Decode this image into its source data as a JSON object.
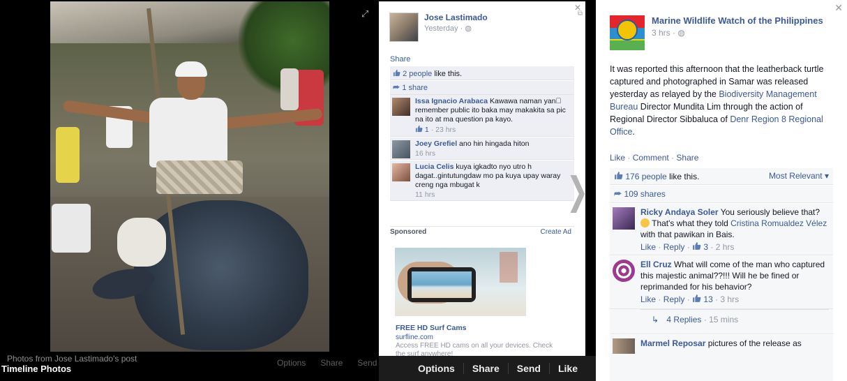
{
  "viewer": {
    "photo_caption": "Photos from Jose Lastimado's post",
    "title": "Timeline Photos",
    "dim_actions": [
      "Options",
      "Share",
      "Send"
    ],
    "actions": [
      "Options",
      "Share",
      "Send",
      "Like"
    ]
  },
  "panel": {
    "author": "Jose Lastimado",
    "time": "Yesterday ·",
    "share_label": "Share",
    "likes_count": "2 people",
    "likes_suffix": " like this.",
    "shares": "1 share",
    "comments": [
      {
        "name": "Issa Ignacio Arabaca",
        "text": " Kawawa naman yan\u0000 remember public ito baka may makakita sa pic na ito at ma question pa kayo.",
        "likes": "1",
        "time": "· 23 hrs"
      },
      {
        "name": "Joey Grefiel",
        "text": " ano hin hingada hiton",
        "time": "16 hrs"
      },
      {
        "name": "Lucia Celis",
        "text": " kuya igkadto nyo utro h dagat..gintutungdaw mo pa kuya upay waray creng nga mbugat k",
        "time": "11 hrs"
      }
    ],
    "sponsored_label": "Sponsored",
    "create_ad": "Create Ad",
    "ad": {
      "title": "FREE HD Surf Cams",
      "url": "surfline.com",
      "desc": "Access FREE HD cams on all your devices. Check the surf anywhere!"
    }
  },
  "right": {
    "page_name": "Marine Wildlife Watch of the Philippines",
    "time": "3 hrs ·",
    "body": {
      "p1": "It was reported this afternoon that the leatherback turtle captured and photographed in Samar was released yesterday as relayed by the ",
      "link1": "Biodiversity Management Bureau",
      "p2": " Director Mundita Lim through the action of Regional Director Sibbaluca of ",
      "link2": "Denr Region 8 Regional Office",
      "p3": "."
    },
    "actions": {
      "like": "Like",
      "comment": "Comment",
      "share": "Share"
    },
    "likes_count": "176 people",
    "likes_suffix": " like this.",
    "most_relevant": "Most Relevant ▾",
    "shares": "109 shares",
    "comments": [
      {
        "name": "Ricky Andaya Soler",
        "text_a": " You seriously believe that? ",
        "text_b": " That's what they told ",
        "tag": "Cristina Romualdez Vélez",
        "text_c": " with that pawikan in Bais.",
        "like": "Like",
        "reply": "Reply",
        "likes": "3",
        "time": "· 2 hrs"
      },
      {
        "name": "Ell Cruz",
        "text": " What will come of the man who captured this majestic animal??!!! Will he be fined or reprimanded for his behavior?",
        "like": "Like",
        "reply": "Reply",
        "likes": "13",
        "time": "· 3 hrs"
      }
    ],
    "replies": "4 Replies",
    "replies_time": "· 15 mins",
    "last_comment": {
      "name": "Marmel Reposar",
      "text": " pictures of the release as"
    }
  }
}
